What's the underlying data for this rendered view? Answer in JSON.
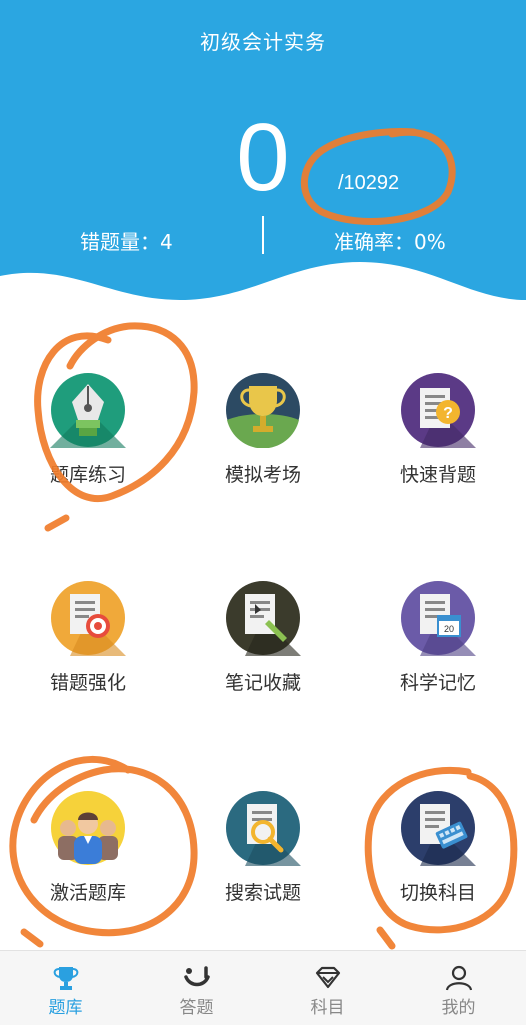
{
  "header": {
    "title": "初级会计实务",
    "done_count": "0",
    "total": "/10292",
    "wrong_label": "错题量：4",
    "accuracy_label": "准确率：0%"
  },
  "grid": [
    {
      "label": "题库练习",
      "icon": "pen-nib-icon"
    },
    {
      "label": "模拟考场",
      "icon": "trophy-icon"
    },
    {
      "label": "快速背题",
      "icon": "question-doc-icon"
    },
    {
      "label": "错题强化",
      "icon": "target-doc-icon"
    },
    {
      "label": "笔记收藏",
      "icon": "note-pencil-icon"
    },
    {
      "label": "科学记忆",
      "icon": "calendar-doc-icon"
    },
    {
      "label": "激活题库",
      "icon": "people-icon"
    },
    {
      "label": "搜索试题",
      "icon": "search-doc-icon"
    },
    {
      "label": "切换科目",
      "icon": "keyboard-doc-icon"
    }
  ],
  "calendar_badge": "20",
  "tabs": [
    {
      "label": "题库",
      "icon": "trophy-tab-icon",
      "active": true
    },
    {
      "label": "答题",
      "icon": "answer-tab-icon",
      "active": false
    },
    {
      "label": "科目",
      "icon": "diamond-tab-icon",
      "active": false
    },
    {
      "label": "我的",
      "icon": "user-tab-icon",
      "active": false
    }
  ],
  "colors": {
    "header_blue": "#2ba6e1",
    "accent": "#2aa0e0",
    "annotation_orange": "#f07c2a"
  }
}
